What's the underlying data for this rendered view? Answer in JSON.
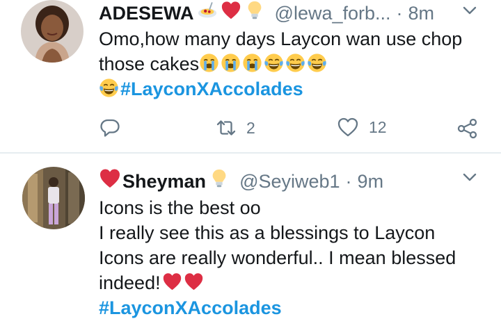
{
  "tweets": [
    {
      "display_name": "ADESEWA",
      "handle": "@lewa_forb...",
      "dot": "·",
      "time": "8m",
      "lines": [
        "Omo,how many days Laycon wan use chop",
        "those cakes"
      ],
      "hashtag": "#LayconXAccolades",
      "reply_count": "",
      "retweet_count": "2",
      "like_count": "12"
    },
    {
      "display_name": "Sheyman",
      "handle": "@Seyiweb1",
      "dot": "·",
      "time": "9m",
      "lines": [
        "Icons is the best oo",
        "I really see this as a blessings to Laycon",
        "Icons are really wonderful.. I mean blessed",
        "indeed!"
      ],
      "hashtag": "#LayconXAccolades"
    }
  ],
  "icons": {
    "reply": "reply-icon",
    "retweet": "retweet-icon",
    "like": "heart-outline-icon",
    "share": "share-icon",
    "caret": "chevron-down-icon"
  },
  "colors": {
    "text": "#14171a",
    "muted": "#657786",
    "link": "#1b95e0",
    "divider": "#e6ecf0",
    "heart_red": "#e0245e"
  }
}
